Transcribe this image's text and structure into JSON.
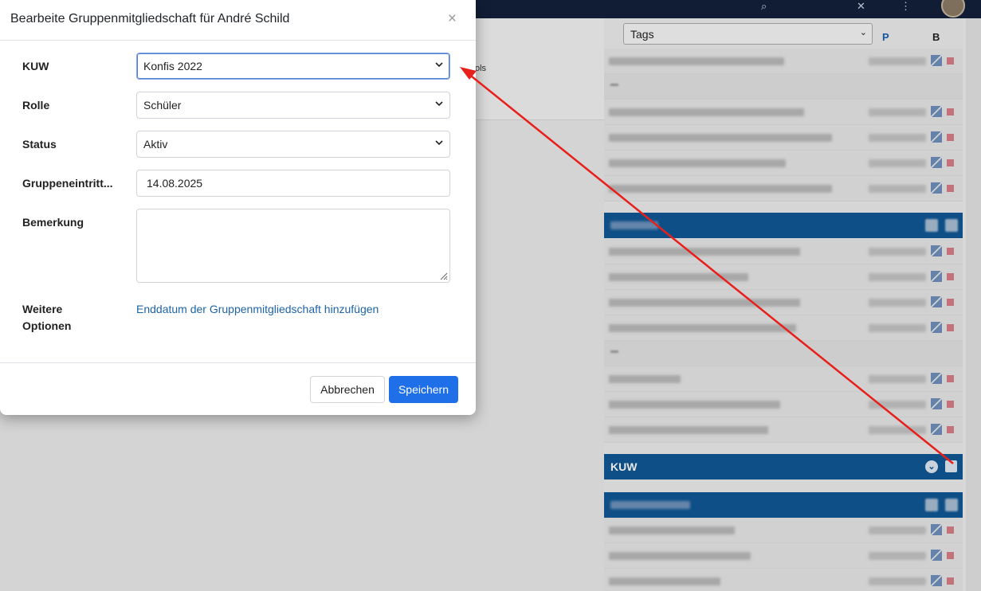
{
  "modal": {
    "title": "Bearbeite Gruppenmitgliedschaft für André Schild",
    "close_glyph": "×",
    "fields": {
      "kuw": {
        "label": "KUW",
        "value": "Konfis 2022"
      },
      "rolle": {
        "label": "Rolle",
        "value": "Schüler"
      },
      "status": {
        "label": "Status",
        "value": "Aktiv"
      },
      "eintritt": {
        "label": "Gruppeneintritt...",
        "value": "14.08.2025"
      },
      "bemerkung": {
        "label": "Bemerkung",
        "value": ""
      },
      "weitere": {
        "label_line1": "Weitere",
        "label_line2": "Optionen",
        "link": "Enddatum der Gruppenmitgliedschaft hinzufügen"
      }
    },
    "buttons": {
      "cancel": "Abbrechen",
      "save": "Speichern"
    }
  },
  "background": {
    "tags_select": "Tags",
    "col_p": "P",
    "col_b": "B",
    "left_fragment": "ols",
    "group_kuw": "KUW"
  },
  "colors": {
    "primary_button": "#1f6fe8",
    "link": "#1d64a8",
    "group_bar": "#0f5794",
    "topbar": "#12203b",
    "annotation_arrow": "#e8201b"
  },
  "icons": {
    "close": "close-icon",
    "select_caret": "chevron-down-icon",
    "resize": "resize-grip-icon",
    "edit": "edit-icon",
    "delete": "delete-icon"
  }
}
